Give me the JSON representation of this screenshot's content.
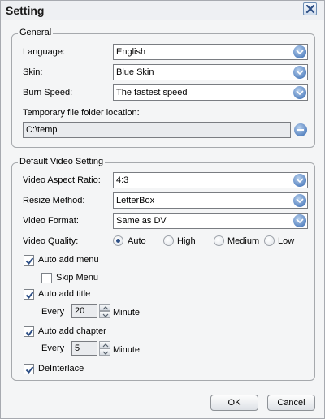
{
  "window": {
    "title": "Setting"
  },
  "general": {
    "legend": "General",
    "language": {
      "label": "Language:",
      "value": "English"
    },
    "skin": {
      "label": "Skin:",
      "value": "Blue Skin"
    },
    "burn_speed": {
      "label": "Burn Speed:",
      "value": "The fastest speed"
    },
    "temp_folder": {
      "label": "Temporary file folder location:",
      "value": "C:\\temp"
    }
  },
  "video": {
    "legend": "Default Video Setting",
    "aspect_ratio": {
      "label": "Video Aspect Ratio:",
      "value": "4:3"
    },
    "resize_method": {
      "label": "Resize Method:",
      "value": "LetterBox"
    },
    "video_format": {
      "label": "Video Format:",
      "value": "Same as DV"
    },
    "quality": {
      "label": "Video Quality:",
      "selected": "Auto",
      "options": [
        "Auto",
        "High",
        "Medium",
        "Low"
      ]
    },
    "auto_add_menu": {
      "label": "Auto add menu",
      "checked": true
    },
    "skip_menu": {
      "label": "Skip Menu",
      "checked": false
    },
    "auto_add_title": {
      "label": "Auto add title",
      "checked": true,
      "every_label": "Every",
      "value": "20",
      "unit": "Minute"
    },
    "auto_add_chapter": {
      "label": "Auto add chapter",
      "checked": true,
      "every_label": "Every",
      "value": "5",
      "unit": "Minute"
    },
    "deinterlace": {
      "label": "DeInterlace",
      "checked": true
    }
  },
  "buttons": {
    "ok": "OK",
    "cancel": "Cancel"
  },
  "colors": {
    "accent": "#5a86c2",
    "border": "#a6a9ad",
    "background": "#f4f5f6"
  }
}
